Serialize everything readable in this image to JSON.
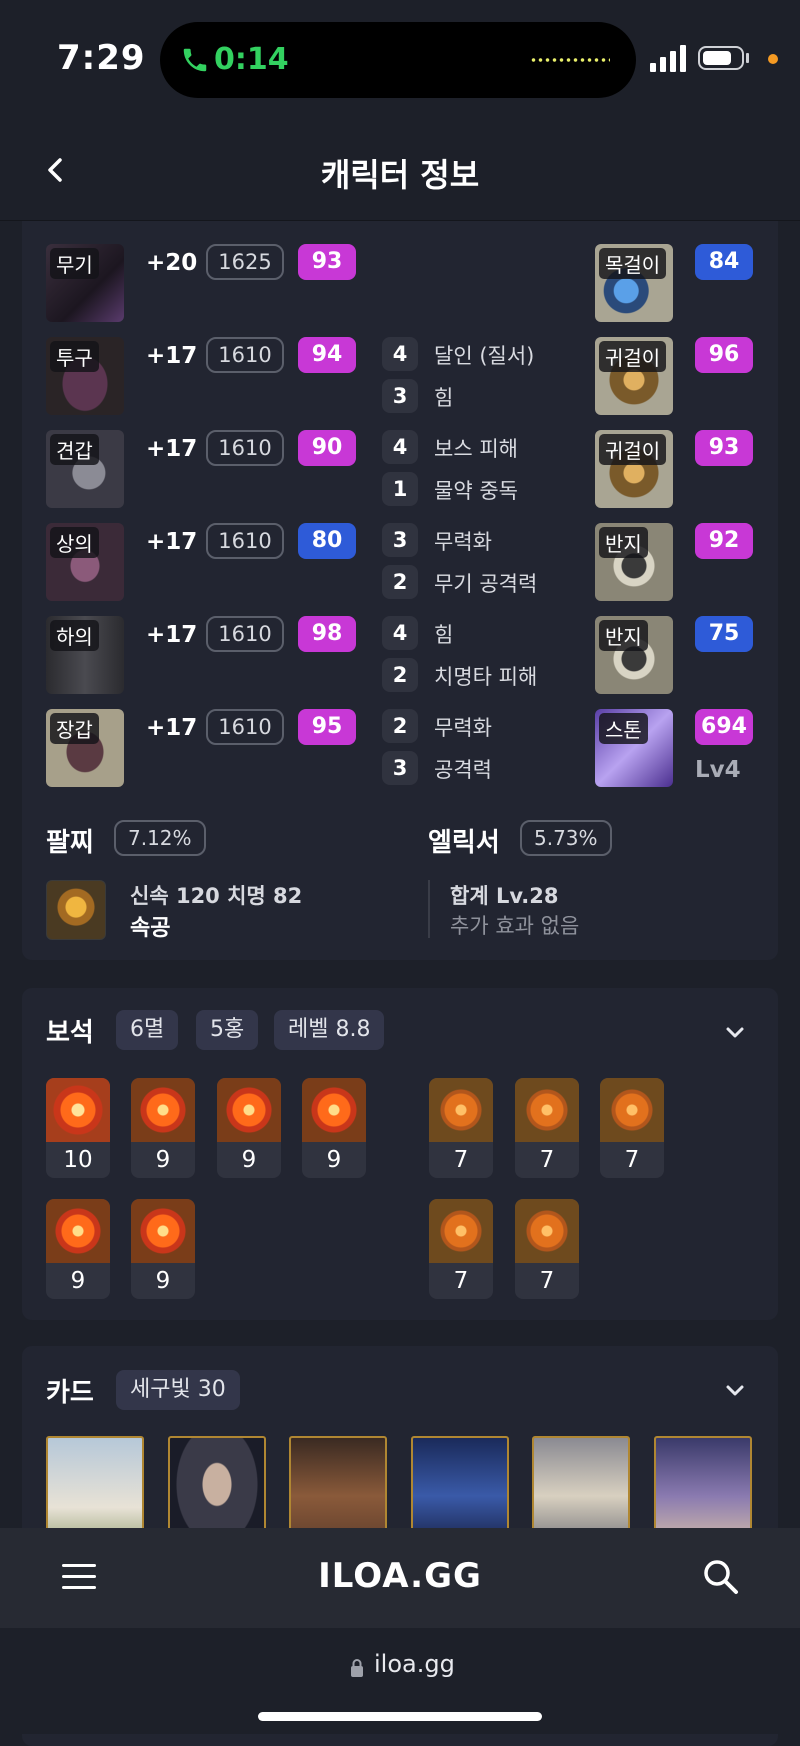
{
  "status": {
    "time": "7:29",
    "call_time": "0:14"
  },
  "header": {
    "title": "캐릭터 정보"
  },
  "equipment": [
    {
      "slot": "무기",
      "refine": "+20",
      "ilvl": "1625",
      "quality": "93",
      "q_color": "#c838d6"
    },
    {
      "slot": "투구",
      "refine": "+17",
      "ilvl": "1610",
      "quality": "94",
      "q_color": "#c838d6"
    },
    {
      "slot": "견갑",
      "refine": "+17",
      "ilvl": "1610",
      "quality": "90",
      "q_color": "#c838d6"
    },
    {
      "slot": "상의",
      "refine": "+17",
      "ilvl": "1610",
      "quality": "80",
      "q_color": "#2e5bd8"
    },
    {
      "slot": "하의",
      "refine": "+17",
      "ilvl": "1610",
      "quality": "98",
      "q_color": "#c838d6"
    },
    {
      "slot": "장갑",
      "refine": "+17",
      "ilvl": "1610",
      "quality": "95",
      "q_color": "#c838d6"
    }
  ],
  "engravings": [
    {
      "level": "4",
      "name": "달인 (질서)"
    },
    {
      "level": "3",
      "name": "힘"
    },
    {
      "level": "4",
      "name": "보스 피해"
    },
    {
      "level": "1",
      "name": "물약 중독"
    },
    {
      "level": "3",
      "name": "무력화"
    },
    {
      "level": "2",
      "name": "무기 공격력"
    },
    {
      "level": "4",
      "name": "힘"
    },
    {
      "level": "2",
      "name": "치명타 피해"
    },
    {
      "level": "2",
      "name": "무력화"
    },
    {
      "level": "3",
      "name": "공격력"
    }
  ],
  "accessories": [
    {
      "slot": "목걸이",
      "quality": "84",
      "q_color": "#2e5bd8"
    },
    {
      "slot": "귀걸이",
      "quality": "96",
      "q_color": "#c838d6"
    },
    {
      "slot": "귀걸이",
      "quality": "93",
      "q_color": "#c838d6"
    },
    {
      "slot": "반지",
      "quality": "92",
      "q_color": "#c838d6"
    },
    {
      "slot": "반지",
      "quality": "75",
      "q_color": "#2e5bd8"
    },
    {
      "slot": "스톤",
      "quality": "694",
      "q_color": "#c838d6",
      "level": "Lv4"
    }
  ],
  "bracelet": {
    "title": "팔찌",
    "percent": "7.12%",
    "stats": "신속 120   치명 82",
    "effect": "속공"
  },
  "elixir": {
    "title": "엘릭서",
    "percent": "5.73%",
    "total": "합계 Lv.28",
    "extra": "추가 효과 없음"
  },
  "gems": {
    "title": "보석",
    "tags": [
      "6멸",
      "5홍",
      "레벨 8.8"
    ],
    "damage_gems": [
      "10",
      "9",
      "9",
      "9",
      "9",
      "9"
    ],
    "cooldown_gems": [
      "7",
      "7",
      "7",
      "7",
      "7"
    ]
  },
  "cards": {
    "title": "카드",
    "set": "세구빛 30"
  },
  "bottom_nav": {
    "brand": "ILOA.GG"
  },
  "browser": {
    "url": "iloa.gg"
  }
}
